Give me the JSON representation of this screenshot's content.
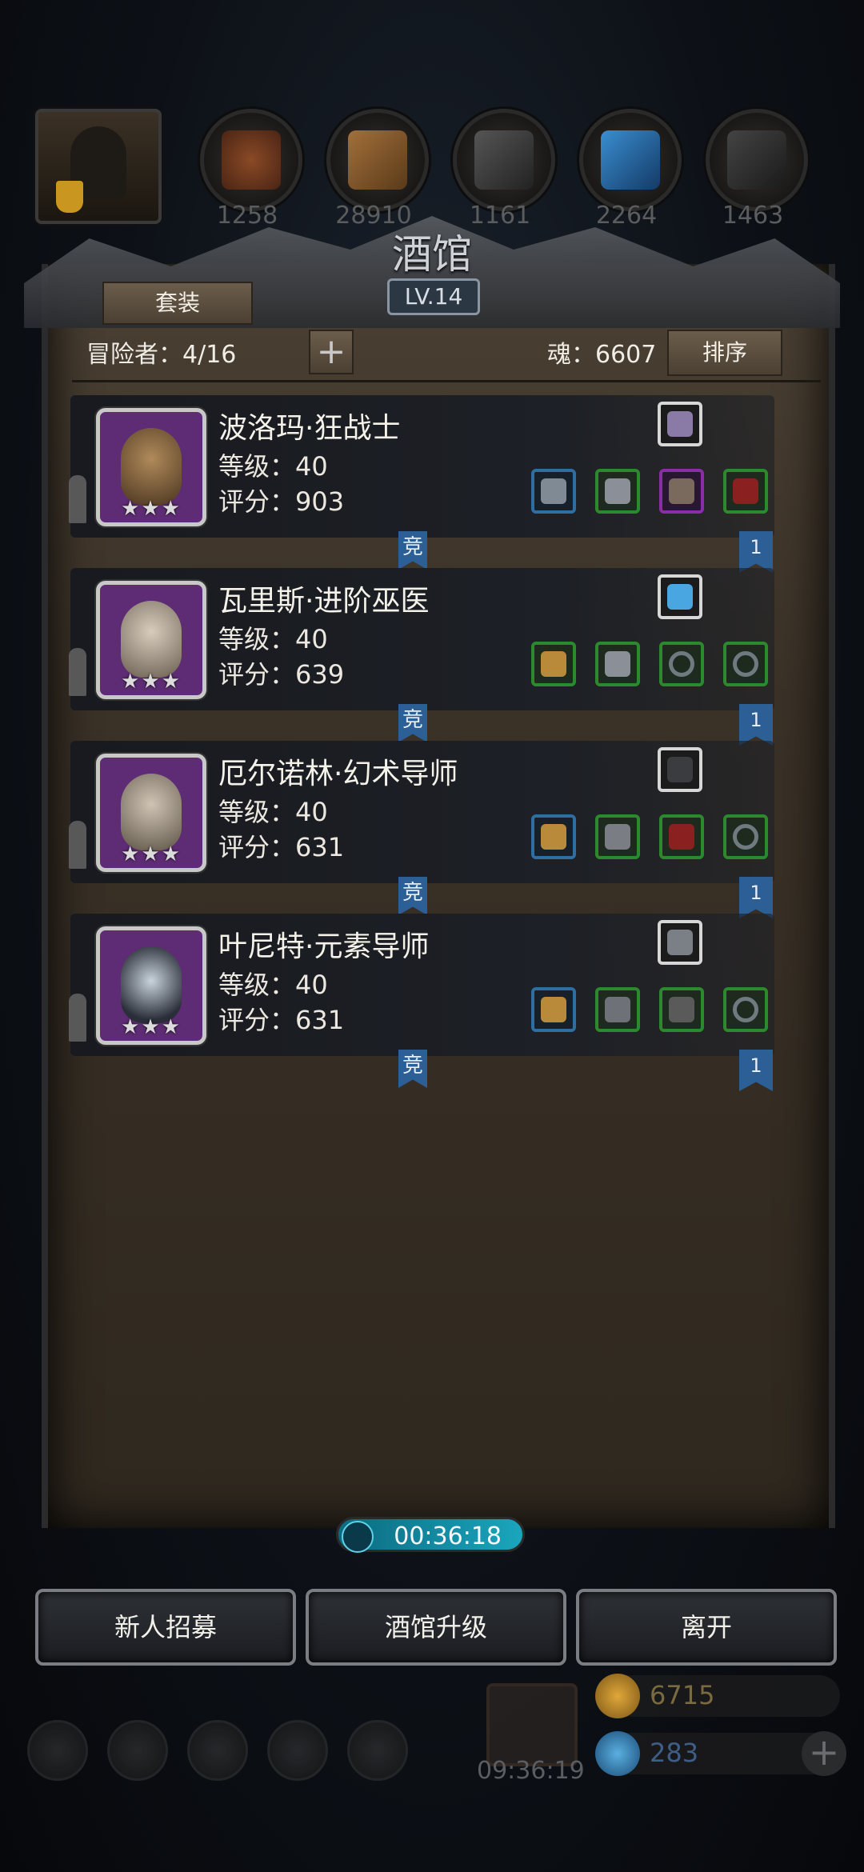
{
  "top_resources": {
    "values": [
      "1258",
      "28910",
      "1161",
      "2264",
      "1463"
    ]
  },
  "tavern": {
    "title": "酒馆",
    "level": "LV.14",
    "suit_button": "套装",
    "adventurers_label": "冒险者：4/16",
    "add_symbol": "+",
    "soul_label": "魂：6607",
    "sort_button": "排序"
  },
  "heroes": [
    {
      "name": "波洛玛·狂战士",
      "level": "等级：40",
      "score": "评分：903",
      "stars": "★★★",
      "arena_badge": "竞",
      "rank_badge": "1"
    },
    {
      "name": "瓦里斯·进阶巫医",
      "level": "等级：40",
      "score": "评分：639",
      "stars": "★★★",
      "arena_badge": "竞",
      "rank_badge": "1"
    },
    {
      "name": "厄尔诺林·幻术导师",
      "level": "等级：40",
      "score": "评分：631",
      "stars": "★★★",
      "arena_badge": "竞",
      "rank_badge": "1"
    },
    {
      "name": "叶尼特·元素导师",
      "level": "等级：40",
      "score": "评分：631",
      "stars": "★★★",
      "arena_badge": "竞",
      "rank_badge": "1"
    }
  ],
  "timer": "00:36:18",
  "buttons": {
    "recruit": "新人招募",
    "upgrade": "酒馆升级",
    "leave": "离开"
  },
  "hud": {
    "gift_timer": "09:36:19",
    "gold": "6715",
    "gems": "283",
    "add_symbol": "+"
  },
  "colors": {
    "accent_blue": "#2c5f95",
    "slot_green": "#2b8a2e",
    "slot_blue": "#2e6ea0",
    "slot_purple": "#8a2ea8",
    "timer_teal": "#1aa6bd",
    "gold": "#c9961f"
  }
}
